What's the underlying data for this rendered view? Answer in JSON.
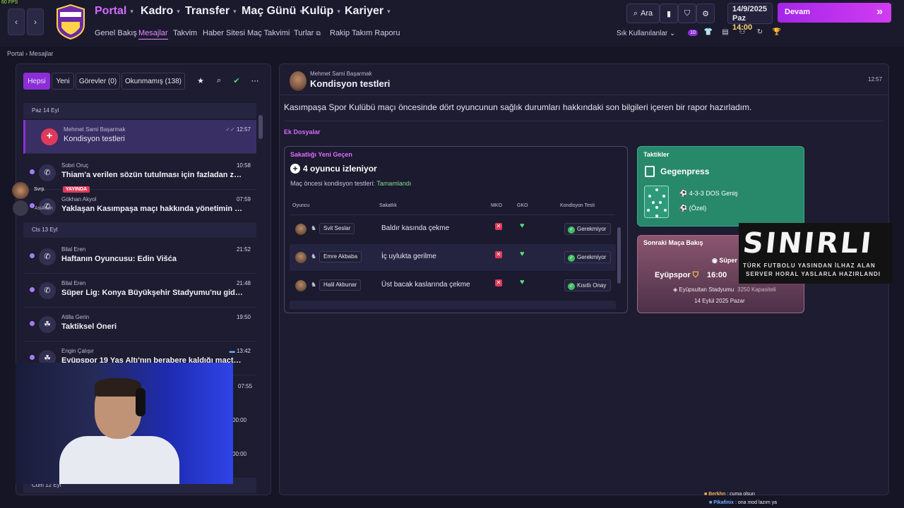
{
  "fps": "60 FPS",
  "nav": {
    "back": "‹",
    "forward": "›",
    "club_logo_text": "EYÜPSPOR",
    "main": [
      {
        "label": "Portal"
      },
      {
        "label": "Kadro"
      },
      {
        "label": "Transfer"
      },
      {
        "label": "Maç Günü"
      },
      {
        "label": "Kulüp"
      },
      {
        "label": "Kariyer"
      }
    ],
    "sub": [
      {
        "label": "Genel Bakış"
      },
      {
        "label": "Mesajlar"
      },
      {
        "label": "Takvim"
      },
      {
        "label": "Haber Sitesi"
      },
      {
        "label": "Maç Takvimi"
      },
      {
        "label": "Turlar"
      },
      {
        "label": "Rakip Takım Raporu"
      }
    ],
    "search_label": "Ara",
    "favorites_label": "Sık Kullanılanlar",
    "badge_count": "10",
    "date": "14/9/2025",
    "day": "Paz",
    "time": "14:00",
    "continue_label": "Devam"
  },
  "breadcrumb": {
    "root": "Portal",
    "current": "Mesajlar"
  },
  "inbox": {
    "tabs": [
      {
        "label": "Hepsi"
      },
      {
        "label": "Yeni"
      },
      {
        "label": "Görevler (0)"
      },
      {
        "label": "Okunmamış (138)"
      }
    ],
    "groups": [
      {
        "label": "Paz 14 Eyl"
      },
      {
        "label": "Cts 13 Eyl"
      }
    ],
    "messages": [
      {
        "sender": "Mehmet Sami Başarmak",
        "subject": "Kondisyon testleri",
        "time": "12:57"
      },
      {
        "sender": "Sobri Oruç",
        "subject": "Thiam'a verilen sözün tutulması için fazladan za...",
        "time": "10:58"
      },
      {
        "sender": "Gökhan Akyol",
        "subject": "Yaklaşan Kasımpaşa maçı hakkında yönetimin ve ...",
        "time": "07:59"
      },
      {
        "sender": "Bilal Eren",
        "subject": "Haftanın Oyuncusu: Edin Višća",
        "time": "21:52"
      },
      {
        "sender": "Bilal Eren",
        "subject": "Süper Lig: Konya Büyükşehir Stadyumu'nu gidenl...",
        "time": "21:48"
      },
      {
        "sender": "Atilla Gerin",
        "subject": "Taktiksel Öneri",
        "time": "19:50"
      },
      {
        "sender": "Engin Çalışır",
        "subject": "Eyüpspor 19 Yaş Altı'nın berabere kaldığı maçta ...",
        "time": "13:42"
      }
    ],
    "hidden_times": [
      "07:55",
      "00:00",
      "00:00"
    ],
    "bottom_group": "Cum 12 Eyl"
  },
  "message": {
    "sender": "Mehmet Sami Başarmak",
    "subject": "Kondisyon testleri",
    "time": "12:57",
    "body": "Kasımpaşa Spor Kulübü maçı öncesinde dört oyuncunun sağlık durumları hakkındaki son bilgileri içeren bir rapor hazırladım.",
    "attachments_title": "Ek Dosyalar"
  },
  "injury": {
    "title": "Sakatlığı Yeni Geçen",
    "count_text": "4 oyuncu izleniyor",
    "sub_label": "Maç öncesi kondisyon testleri:",
    "sub_status": "Tamamlandı",
    "headers": {
      "player": "Oyuncu",
      "injury": "Sakatlık",
      "mko": "MKO",
      "gko": "GKO",
      "test": "Kondisyon Testi"
    },
    "rows": [
      {
        "name": "Svit Seslar",
        "injury": "Baldır kasında çekme",
        "status": "Gerekmiyor"
      },
      {
        "name": "Emre Akbaba",
        "injury": "İç uylukta gerilme",
        "status": "Gerekmiyor"
      },
      {
        "name": "Halil Akbunar",
        "injury": "Üst bacak kaslarında çekme",
        "status": "Kısıtlı Onay"
      }
    ]
  },
  "tactic": {
    "title": "Taktikler",
    "name": "Gegenpress",
    "formation": "4-3-3 DOS Geniş",
    "variant": "(Özel)"
  },
  "next_match": {
    "title": "Sonraki Maça Bakış",
    "league": "Süper Lig",
    "home": "Eyüpspor",
    "time": "16:00",
    "stadium": "Eyüpsultan Stadyumu",
    "capacity": "3250 Kapasiteli",
    "date": "14 Eylül 2025 Pazar"
  },
  "overlay": {
    "big": "SINIRLI",
    "line1": "TÜRK FUTBOLU YASINDAN İLHAZ ALAN",
    "line2": "SERVER HORAL YASLARLA HAZIRLANDI"
  },
  "stream": {
    "live_name": "Svrp.",
    "live_badge": "YAYINDA",
    "second_name": "AsiAsan",
    "chat": [
      {
        "user": "Berkhn",
        "text": ": cuma olsun",
        "color": "#f0b35a"
      },
      {
        "user": "Pikafinix",
        "text": ": ona mod lazım ya",
        "color": "#6ab0ff"
      }
    ]
  },
  "colors": {
    "accent": "#8d2dd8",
    "tactic_card": "#27886a",
    "next_match_card": "#8c5670",
    "ok_green": "#3fbf63",
    "injury_red": "#e03a5a"
  }
}
